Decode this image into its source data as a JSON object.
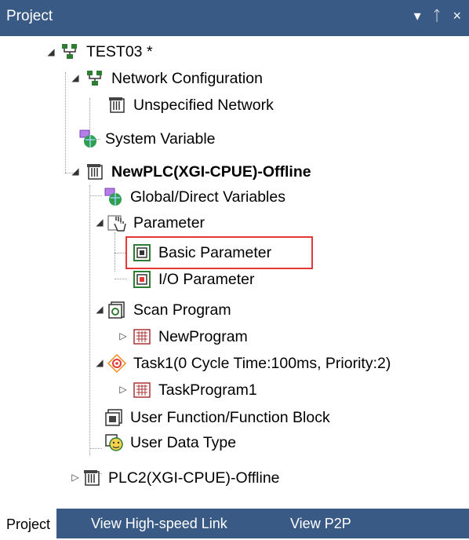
{
  "panel": {
    "title": "Project",
    "controls": {
      "dropdown": "▾",
      "pin": "ᛏ",
      "close": "×"
    }
  },
  "tree": {
    "root": "TEST03 *",
    "network_configuration": "Network Configuration",
    "unspecified_network": "Unspecified Network",
    "system_variable": "System Variable",
    "plc1": "NewPLC(XGI-CPUE)-Offline",
    "global_direct_variables": "Global/Direct Variables",
    "parameter": "Parameter",
    "basic_parameter": "Basic Parameter",
    "io_parameter": "I/O Parameter",
    "scan_program": "Scan Program",
    "new_program": "NewProgram",
    "task1": "Task1(0 Cycle Time:100ms, Priority:2)",
    "task_program1": "TaskProgram1",
    "user_function_block": "User Function/Function Block",
    "user_data_type": "User Data Type",
    "plc2": "PLC2(XGI-CPUE)-Offline"
  },
  "tabs": [
    "Project",
    "View High-speed Link",
    "View P2P"
  ],
  "colors": {
    "title_bar": "#3a5a86",
    "highlight_box": "#e53935",
    "tab_bar": "#3a5a86"
  }
}
